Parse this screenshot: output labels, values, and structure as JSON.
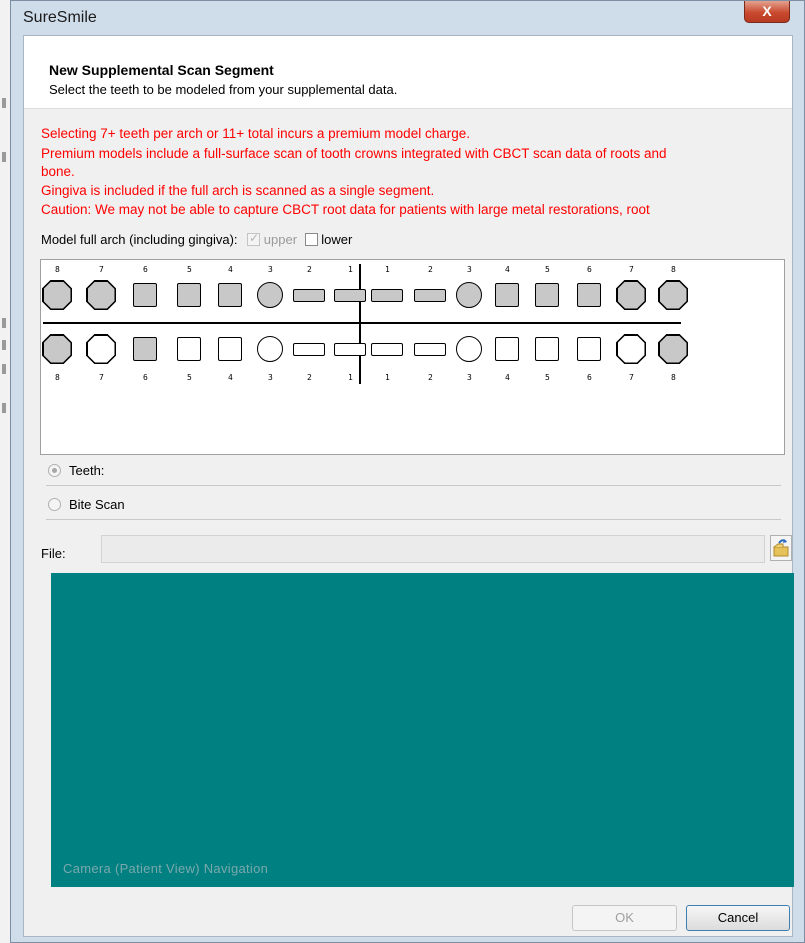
{
  "window": {
    "title": "SureSmile",
    "close_glyph": "X"
  },
  "header": {
    "title": "New Supplemental Scan Segment",
    "subtitle": "Select the teeth to be modeled from your supplemental data."
  },
  "warnings": [
    "Selecting 7+ teeth per arch or 11+ total incurs a premium model charge.",
    "Premium models include a full-surface scan of tooth crowns integrated with CBCT scan data of roots and",
    "bone.",
    "Gingiva is included if the full arch is scanned as a single segment.",
    "Caution: We may not be able to capture CBCT root data for patients with large metal restorations, root"
  ],
  "arch_options": {
    "label": "Model full arch (including gingiva):",
    "upper": {
      "label": "upper",
      "checked": true,
      "enabled": false
    },
    "lower": {
      "label": "lower",
      "checked": false,
      "enabled": true
    }
  },
  "tooth_chart": {
    "upper_numbers": [
      "8",
      "7",
      "6",
      "5",
      "4",
      "3",
      "2",
      "1",
      "1",
      "2",
      "3",
      "4",
      "5",
      "6",
      "7",
      "8"
    ],
    "lower_numbers": [
      "8",
      "7",
      "6",
      "5",
      "4",
      "3",
      "2",
      "1",
      "1",
      "2",
      "3",
      "4",
      "5",
      "6",
      "7",
      "8"
    ],
    "upper_shapes": [
      "oct",
      "oct",
      "sq",
      "sq",
      "sq",
      "round",
      "bar",
      "bar",
      "bar",
      "bar",
      "round",
      "sq",
      "sq",
      "sq",
      "oct",
      "oct"
    ],
    "lower_shapes": [
      "oct",
      "oct",
      "sq",
      "sq",
      "sq",
      "round",
      "bar",
      "bar",
      "bar",
      "bar",
      "round",
      "sq",
      "sq",
      "sq",
      "oct",
      "oct"
    ],
    "upper_selected": [
      true,
      true,
      true,
      true,
      true,
      true,
      true,
      true,
      true,
      true,
      true,
      true,
      true,
      true,
      true,
      true
    ],
    "lower_selected": [
      true,
      false,
      true,
      false,
      false,
      false,
      false,
      false,
      false,
      false,
      false,
      false,
      false,
      false,
      false,
      true
    ],
    "selected_color": "#c8c8c8"
  },
  "segment_type": {
    "teeth": {
      "label": "Teeth:",
      "selected": true
    },
    "bite_scan": {
      "label": "Bite Scan",
      "selected": false
    }
  },
  "file": {
    "label": "File:",
    "value": "",
    "browse_icon": "folder-open-icon"
  },
  "viewport": {
    "label": "Camera (Patient View) Navigation",
    "background": "#008080"
  },
  "buttons": {
    "ok": "OK",
    "cancel": "Cancel"
  }
}
